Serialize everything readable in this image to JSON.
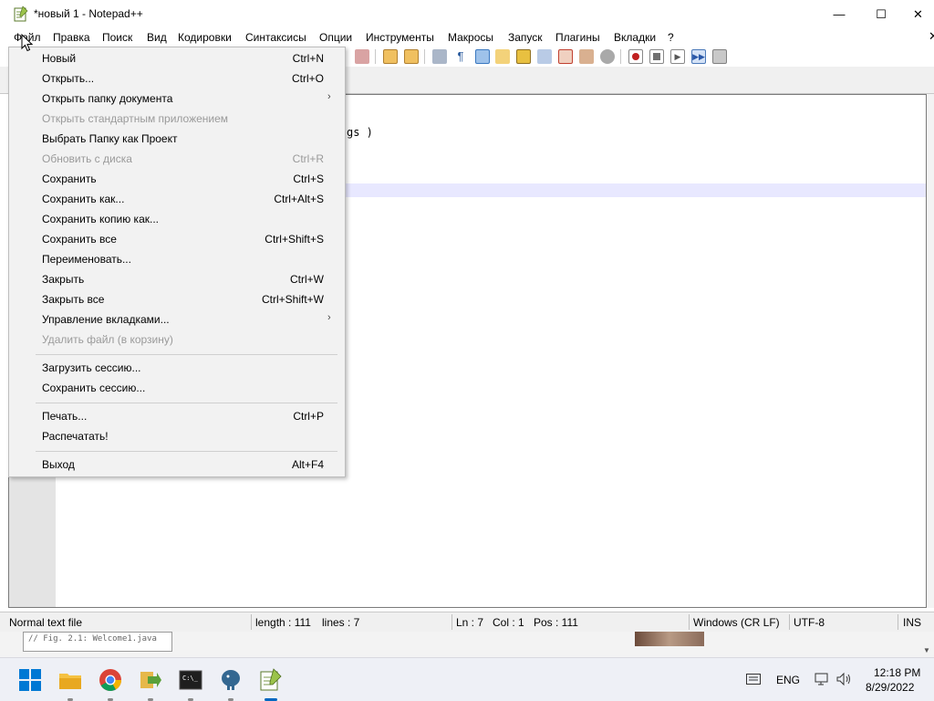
{
  "window": {
    "title": "*новый 1 - Notepad++",
    "minimize_glyph": "—",
    "maximize_glyph": "☐",
    "close_glyph": "✕"
  },
  "menubar": {
    "items": [
      "Файл",
      "Правка",
      "Поиск",
      "Вид",
      "Кодировки",
      "Синтаксисы",
      "Опции",
      "Инструменты",
      "Макросы",
      "Запуск",
      "Плагины",
      "Вкладки",
      "?"
    ],
    "close_glyph": "✕"
  },
  "file_menu": {
    "items": [
      {
        "label": "Новый",
        "shortcut": "Ctrl+N"
      },
      {
        "label": "Открыть...",
        "shortcut": "Ctrl+O"
      },
      {
        "label": "Открыть папку документа",
        "shortcut": "",
        "submenu": "›"
      },
      {
        "label": "Открыть стандартным приложением",
        "shortcut": ""
      },
      {
        "label": "Выбрать Папку как Проект",
        "shortcut": ""
      },
      {
        "label": "Обновить с диска",
        "shortcut": "Ctrl+R"
      },
      {
        "label": "Сохранить",
        "shortcut": "Ctrl+S"
      },
      {
        "label": "Сохранить как...",
        "shortcut": "Ctrl+Alt+S"
      },
      {
        "label": "Сохранить копию как...",
        "shortcut": ""
      },
      {
        "label": "Сохранить все",
        "shortcut": "Ctrl+Shift+S"
      },
      {
        "label": "Переименовать...",
        "shortcut": ""
      },
      {
        "label": "Закрыть",
        "shortcut": "Ctrl+W"
      },
      {
        "label": "Закрыть все",
        "shortcut": "Ctrl+Shift+W"
      },
      {
        "label": "Управление вкладками...",
        "shortcut": "",
        "submenu": "›"
      },
      {
        "label": "Удалить файл (в корзину)",
        "shortcut": ""
      },
      {
        "label": "Загрузить сессию...",
        "shortcut": ""
      },
      {
        "label": "Сохранить сессию...",
        "shortcut": ""
      },
      {
        "label": "Печать...",
        "shortcut": "Ctrl+P"
      },
      {
        "label": "Распечатать!",
        "shortcut": ""
      },
      {
        "label": "Выход",
        "shortcut": "Alt+F4"
      }
    ]
  },
  "editor": {
    "visible_code_fragment": "gs )"
  },
  "statusbar": {
    "file_type": "Normal text file",
    "length": "length : 111",
    "lines": "lines : 7",
    "ln": "Ln : 7",
    "col": "Col : 1",
    "pos": "Pos : 111",
    "eol": "Windows (CR LF)",
    "encoding": "UTF-8",
    "mode": "INS"
  },
  "background": {
    "snippet": "// Fig. 2.1: Welcome1.java"
  },
  "taskbar": {
    "lang": "ENG",
    "time": "12:18 PM",
    "date": "8/29/2022"
  },
  "colors": {
    "accent": "#0067c0",
    "current_line": "#e8e8ff",
    "disabled_text": "#9a9a9a"
  }
}
